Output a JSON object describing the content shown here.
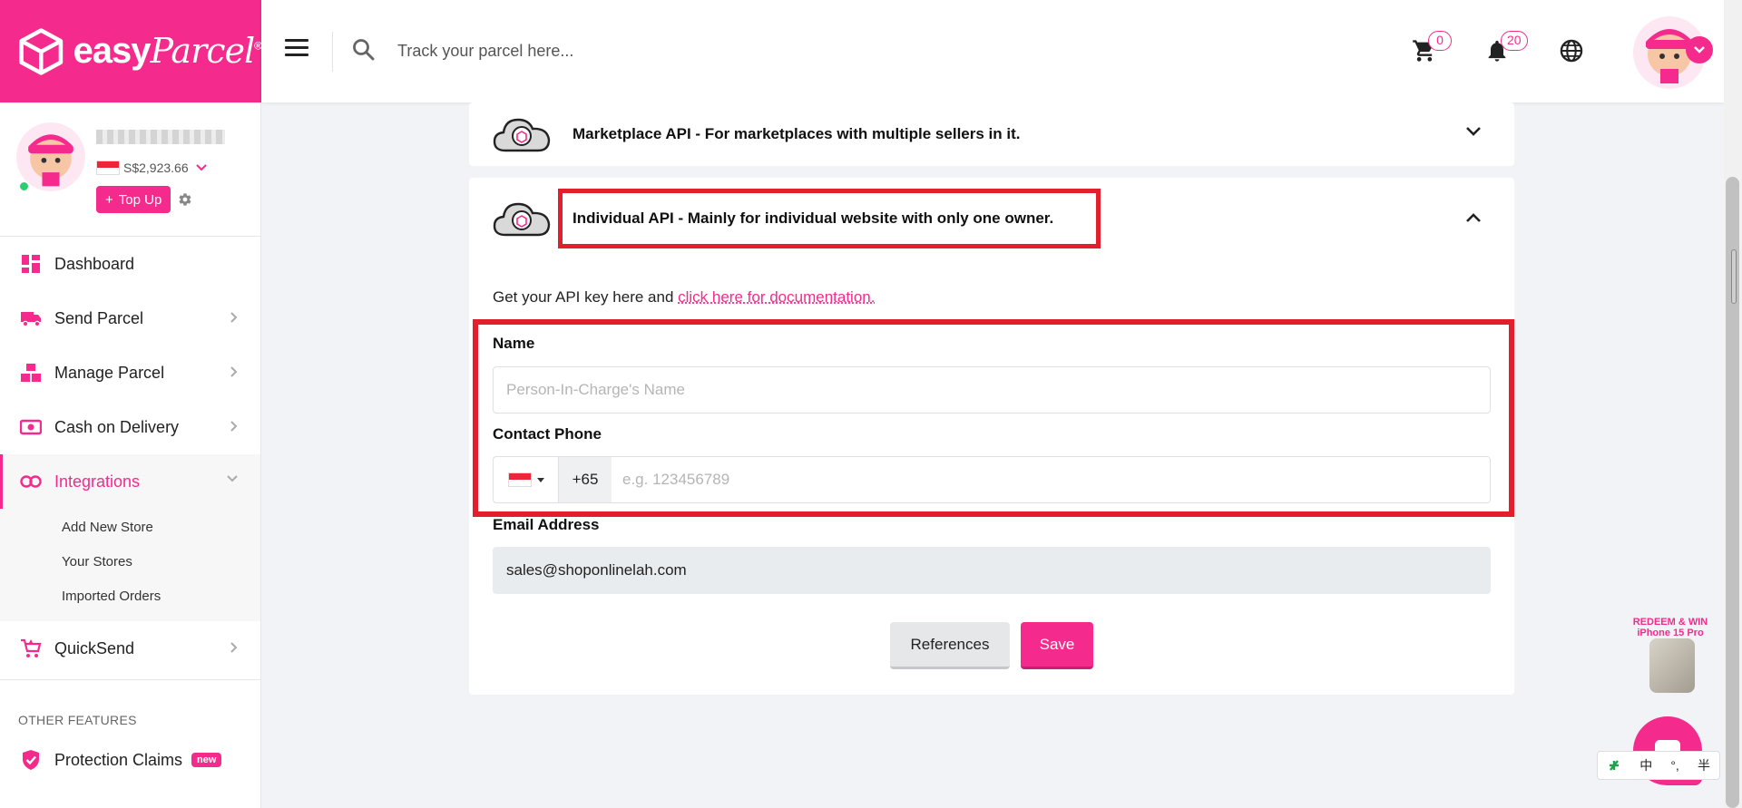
{
  "brand": {
    "name_bold": "easy",
    "name_script": "Parcel",
    "mark": "®"
  },
  "header": {
    "search_placeholder": "Track your parcel here...",
    "cart_count": "0",
    "notification_count": "20"
  },
  "sidebar": {
    "balance": "S$2,923.66",
    "topup_label": "Top Up",
    "nav": [
      {
        "label": "Dashboard"
      },
      {
        "label": "Send Parcel"
      },
      {
        "label": "Manage Parcel"
      },
      {
        "label": "Cash on Delivery"
      },
      {
        "label": "Integrations"
      },
      {
        "label": "QuickSend"
      }
    ],
    "integrations_sub": [
      "Add New Store",
      "Your Stores",
      "Imported Orders"
    ],
    "other_title": "OTHER FEATURES",
    "protection_claims": "Protection Claims",
    "new_badge": "new"
  },
  "main": {
    "marketplace_api_title": "Marketplace API - For marketplaces with multiple sellers in it.",
    "individual_api_title": "Individual API - Mainly for individual website with only one owner.",
    "intro_text": "Get your API key here and ",
    "doc_link": "click here for documentation.",
    "name_label": "Name",
    "name_placeholder": "Person-In-Charge's Name",
    "phone_label": "Contact Phone",
    "dial_code": "+65",
    "phone_placeholder": "e.g. 123456789",
    "email_label": "Email Address",
    "email_value": "sales@shoponlinelah.com",
    "references_label": "References",
    "save_label": "Save"
  },
  "widgets": {
    "promo_line1": "REDEEM & WIN",
    "promo_line2": "iPhone 15 Pro",
    "ime_chars": [
      "中",
      "°,",
      "半"
    ]
  },
  "colors": {
    "brand_pink": "#f42b8c",
    "highlight_red": "#e31e2d",
    "online_green": "#2ecc71"
  }
}
